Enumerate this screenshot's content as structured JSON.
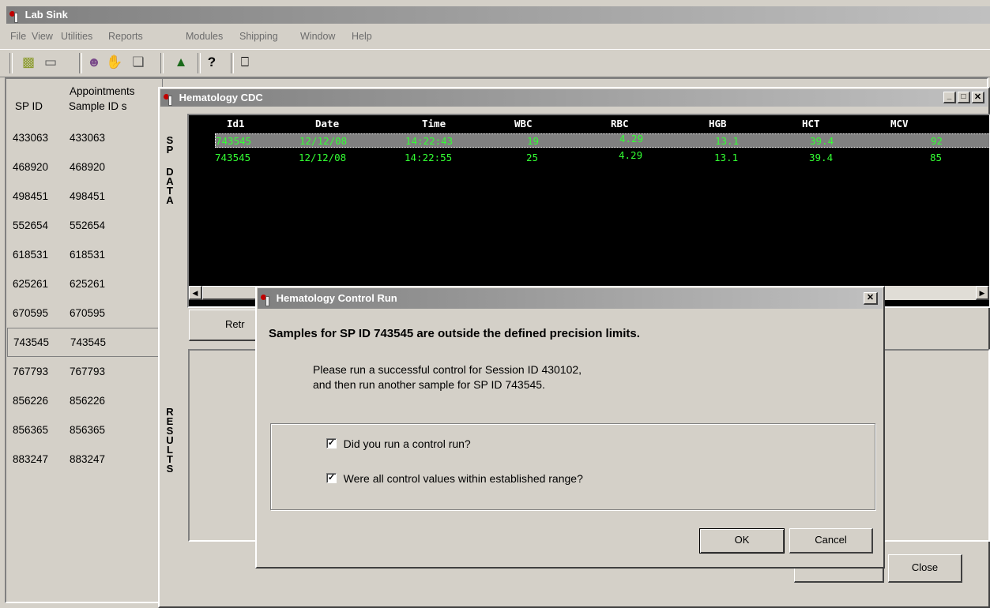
{
  "app": {
    "title": "Lab Sink"
  },
  "menu": [
    "File",
    "View",
    "Utilities",
    "Reports",
    "Modules",
    "Shipping",
    "Window",
    "Help"
  ],
  "toolbar_icons": [
    "new-icon",
    "open-icon",
    "people-icon",
    "hand-icon",
    "tag-icon",
    "chart-icon",
    "help-icon",
    "exit-icon"
  ],
  "appointments": {
    "title": "Appointments",
    "col_spid": "SP ID",
    "col_sample": "Sample ID s",
    "rows": [
      [
        "433063",
        "433063"
      ],
      [
        "468920",
        "468920"
      ],
      [
        "498451",
        "498451"
      ],
      [
        "552654",
        "552654"
      ],
      [
        "618531",
        "618531"
      ],
      [
        "625261",
        "625261"
      ],
      [
        "670595",
        "670595"
      ],
      [
        "743545",
        "743545"
      ],
      [
        "767793",
        "767793"
      ],
      [
        "856226",
        "856226"
      ],
      [
        "856365",
        "856365"
      ],
      [
        "883247",
        "883247"
      ]
    ],
    "selected_index": 7
  },
  "hematology": {
    "title": "Hematology CDC",
    "sp_data_label": [
      "S",
      "P",
      "",
      "D",
      "A",
      "T",
      "A"
    ],
    "results_label": [
      "R",
      "E",
      "S",
      "U",
      "L",
      "T",
      "S"
    ],
    "grid": {
      "headers": [
        "Id1",
        "Date",
        "Time",
        "WBC",
        "RBC",
        "HGB",
        "HCT",
        "MCV"
      ],
      "rows": [
        [
          "743545",
          "12/12/08",
          "14:22:43",
          "19",
          "4.29",
          "13.1",
          "39.4",
          "92"
        ],
        [
          "743545",
          "12/12/08",
          "14:22:55",
          "25",
          "4.29",
          "13.1",
          "39.4",
          "85"
        ]
      ],
      "selected_row": 0
    },
    "retrieve_label": "Retr",
    "close_label": "Close",
    "hidden_button_label": "–"
  },
  "dialog": {
    "title": "Hematology Control Run",
    "heading": "Samples for SP ID 743545 are outside the defined precision limits.",
    "message_line1": "Please run a successful control for Session ID 430102,",
    "message_line2": "and then run another sample for SP ID 743545.",
    "check1_label": "Did you run a control run?",
    "check2_label": "Were all control values within established range?",
    "check1_checked": true,
    "check2_checked": true,
    "ok_label": "OK",
    "cancel_label": "Cancel"
  }
}
